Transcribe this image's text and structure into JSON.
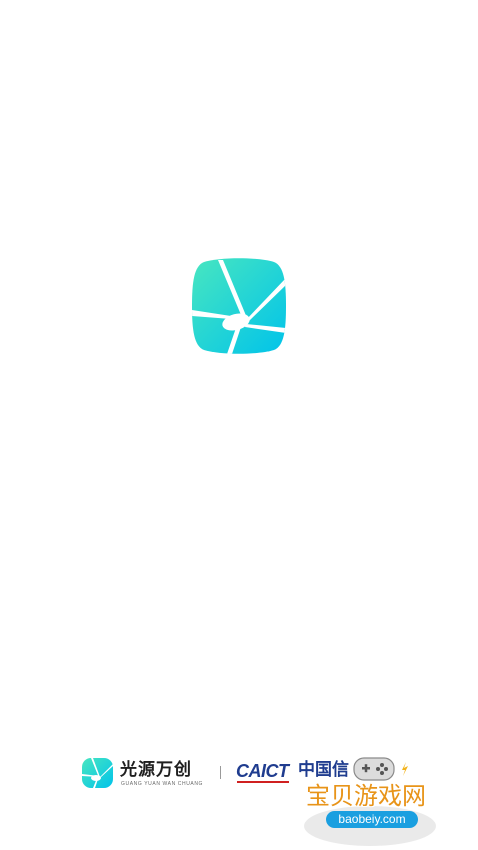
{
  "app": {
    "logo_icon": "star-burst-rounded-square-icon",
    "accent_gradient": [
      "#3fe3c4",
      "#00c6e8"
    ]
  },
  "footer": {
    "brand": {
      "icon": "star-burst-icon",
      "name_cn": "光源万创",
      "name_en": "GUANG YUAN WAN CHUANG"
    },
    "partner": {
      "name_en": "CAICT",
      "name_cn": "中国信",
      "color": "#1f3c8f",
      "underline_color": "#d02020"
    }
  },
  "watermark": {
    "text_cn": "宝贝游戏网",
    "url": "baobeiy.com",
    "icon": "gamepad-icon",
    "colors": {
      "text": "#e89419",
      "badge": "#1a9fe0"
    }
  }
}
